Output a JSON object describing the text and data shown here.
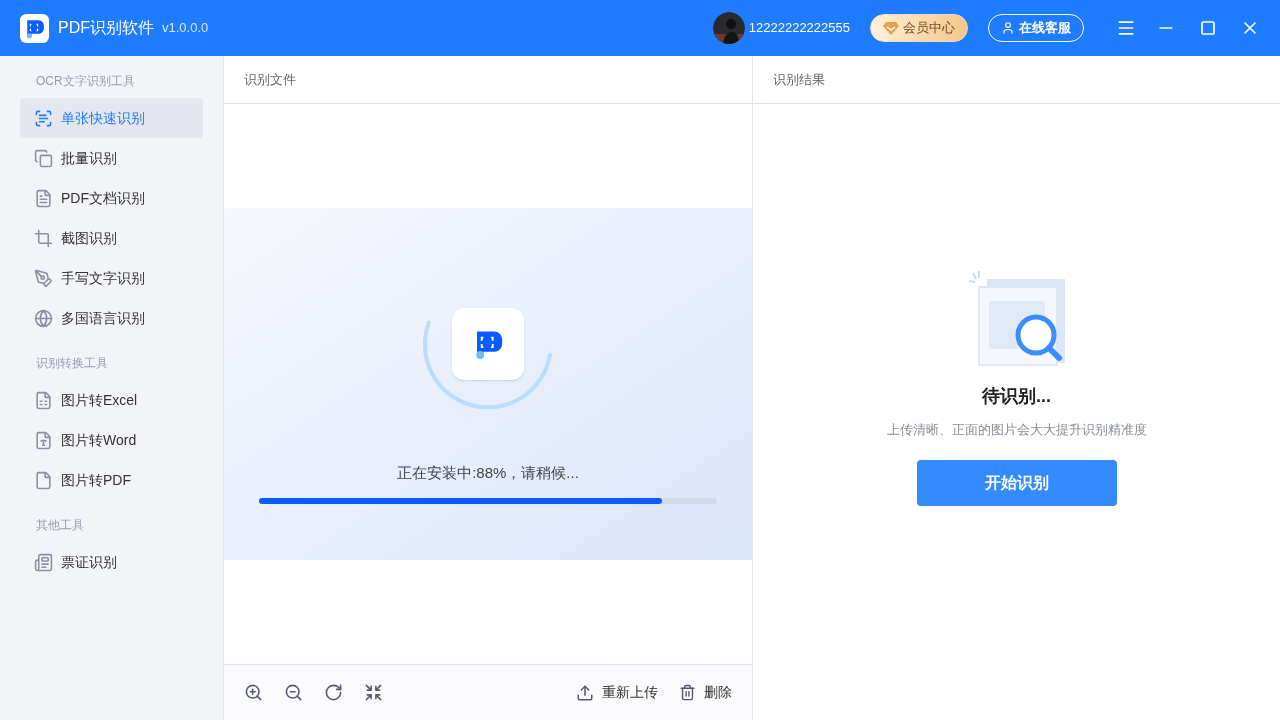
{
  "titlebar": {
    "app_name": "PDF识别软件",
    "version": "v1.0.0.0",
    "user": "12222222222555",
    "vip_button": "会员中心",
    "service_button": "在线客服"
  },
  "sidebar": {
    "sections": [
      {
        "title": "OCR文字识别工具",
        "items": [
          {
            "label": "单张快速识别",
            "selected": true
          },
          {
            "label": "批量识别",
            "selected": false
          },
          {
            "label": "PDF文档识别",
            "selected": false
          },
          {
            "label": "截图识别",
            "selected": false
          },
          {
            "label": "手写文字识别",
            "selected": false
          },
          {
            "label": "多国语言识别",
            "selected": false
          }
        ]
      },
      {
        "title": "识别转换工具",
        "items": [
          {
            "label": "图片转Excel",
            "selected": false
          },
          {
            "label": "图片转Word",
            "selected": false
          },
          {
            "label": "图片转PDF",
            "selected": false
          }
        ]
      },
      {
        "title": "其他工具",
        "items": [
          {
            "label": "票证识别",
            "selected": false
          }
        ]
      }
    ]
  },
  "file_panel": {
    "title": "识别文件",
    "install": {
      "message": "正在安装中:88%，请稍候...",
      "level": 0.88
    },
    "actions": [
      "重新上传",
      "删除"
    ]
  },
  "result_panel": {
    "title": "识别结果",
    "status": "待识别...",
    "hint": "上传清晰、正面的图片会大大提升识别精准度",
    "button": "开始识别"
  }
}
